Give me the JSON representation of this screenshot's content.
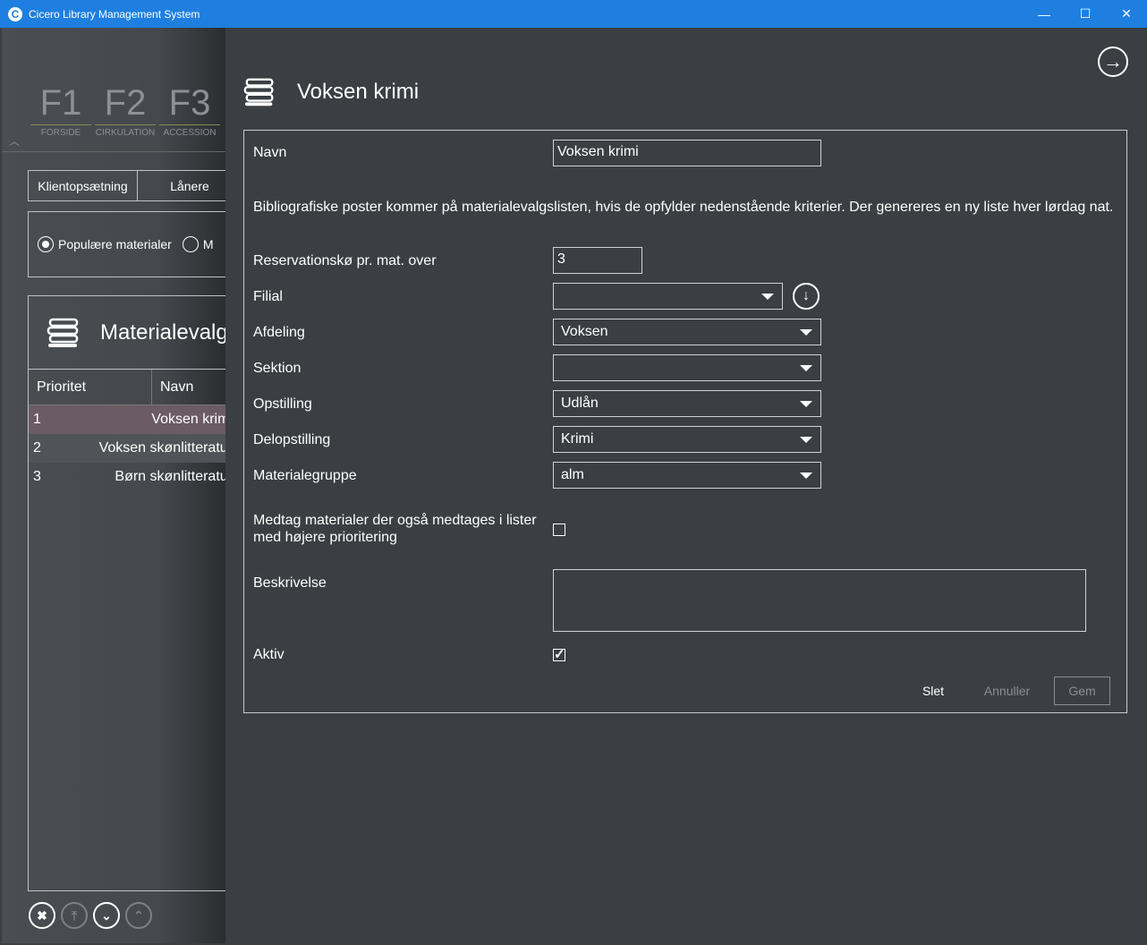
{
  "window": {
    "title": "Cicero Library Management System",
    "icon_letter": "C",
    "minimize": "—",
    "maximize": "☐",
    "close": "✕"
  },
  "background": {
    "fkeys": [
      {
        "key": "F1",
        "label": "FORSIDE"
      },
      {
        "key": "F2",
        "label": "CIRKULATION"
      },
      {
        "key": "F3",
        "label": "ACCESSION"
      }
    ],
    "collapse_caret": "︿",
    "tabs": [
      "Klientopsætning",
      "Lånere"
    ],
    "radios": [
      "Populære materialer",
      "M"
    ],
    "list_title": "Materialevalg",
    "columns": [
      "Prioritet",
      "Navn"
    ],
    "rows": [
      {
        "prio": "1",
        "name": "Voksen krimi"
      },
      {
        "prio": "2",
        "name": "Voksen skønlitteratur"
      },
      {
        "prio": "3",
        "name": "Børn skønlitteratur"
      }
    ],
    "bottom_buttons": [
      "✖",
      "⤒",
      "⌄",
      "⌃"
    ]
  },
  "detail": {
    "title": "Voksen krimi",
    "close_glyph": "→",
    "download_glyph": "↓",
    "navn_label": "Navn",
    "navn_value": "Voksen krimi",
    "info": "Bibliografiske poster kommer på materialevalgslisten, hvis de opfylder nedenstående kriterier. Der genereres en ny liste hver lørdag nat.",
    "reservation_label": "Reservationskø pr. mat. over",
    "reservation_value": "3",
    "filial_label": "Filial",
    "filial_value": "",
    "afdeling_label": "Afdeling",
    "afdeling_value": "Voksen",
    "sektion_label": "Sektion",
    "sektion_value": "",
    "opstilling_label": "Opstilling",
    "opstilling_value": "Udlån",
    "delopstilling_label": "Delopstilling",
    "delopstilling_value": "Krimi",
    "materialegruppe_label": "Materialegruppe",
    "materialegruppe_value": "alm",
    "medtag_label_1": "Medtag materialer der også medtages i lister",
    "medtag_label_2": "med højere prioritering",
    "beskrivelse_label": "Beskrivelse",
    "aktiv_label": "Aktiv",
    "slet": "Slet",
    "annuller": "Annuller",
    "gem": "Gem"
  },
  "colors": {
    "titlebar": "#1e7fe0",
    "panel": "#3b3e43",
    "selected_row": "#6a5b65"
  }
}
